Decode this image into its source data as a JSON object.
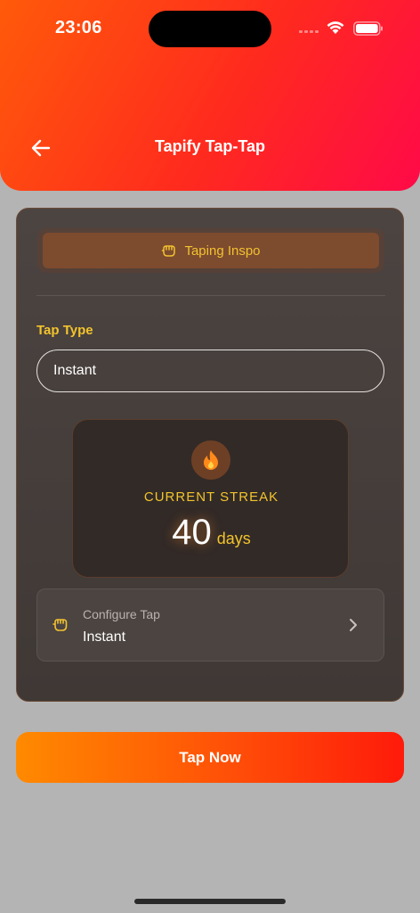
{
  "status_bar": {
    "time": "23:06"
  },
  "header": {
    "title": "Tapify Tap-Tap"
  },
  "inspo": {
    "label": "Taping Inspo"
  },
  "tap_type": {
    "label": "Tap Type",
    "value": "Instant"
  },
  "streak": {
    "label": "CURRENT STREAK",
    "value": "40",
    "unit": "days"
  },
  "configure": {
    "title": "Configure Tap",
    "value": "Instant"
  },
  "tap_now": {
    "label": "Tap Now"
  },
  "colors": {
    "accent": "#f2c42c",
    "header_start": "#ff5a0a",
    "header_end": "#ff0a48",
    "button_start": "#ff8a00"
  },
  "icons": [
    "back-arrow-icon",
    "fist-icon",
    "flame-icon",
    "chevron-right-icon",
    "wifi-icon",
    "battery-icon"
  ]
}
